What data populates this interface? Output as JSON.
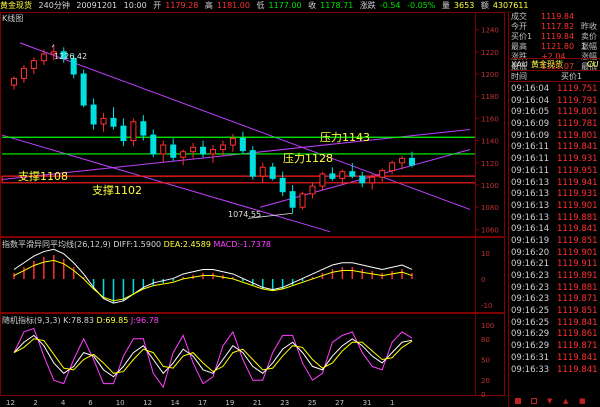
{
  "header": {
    "instrument": "黄金现货",
    "period": "240分钟",
    "date": "20091201",
    "time": "10:00",
    "open_label": "开",
    "open": "1179.28",
    "high_label": "高",
    "high": "1181.00",
    "low_label": "低",
    "low": "1177.00",
    "close_label": "收",
    "close": "1178.71",
    "change_label": "涨跌",
    "change": "-0.54",
    "change_pct": "-0.05%",
    "volume_label": "量",
    "volume": "3653",
    "amount_label": "额",
    "amount": "4307611"
  },
  "main_panel": {
    "title": "K线图",
    "price_ticks": [
      "1240",
      "1220",
      "1200",
      "1180",
      "1160",
      "1140",
      "1120",
      "1100",
      "1080",
      "1060"
    ],
    "annotations": {
      "high_label": "1226.42",
      "low_label": "1074.55",
      "resistance_1": "压力1143",
      "resistance_2": "压力1128",
      "support_1": "支撑1108",
      "support_2": "支撑1102"
    }
  },
  "macd_panel": {
    "title": "指数平滑异同平均线",
    "params": "(26,12,9)",
    "diff_label": "DIFF:1.5900",
    "dea_label": "DEA:2.4589",
    "macd_label": "MACD:-1.7378",
    "ticks": [
      "10",
      "0",
      "-10"
    ]
  },
  "kdj_panel": {
    "title": "随机指标",
    "params": "(9,3,3)",
    "k_label": "K:78.83",
    "d_label": "D:69.85",
    "j_label": "J:96.78",
    "ticks": [
      "100",
      "80",
      "50",
      "20",
      "0"
    ]
  },
  "x_axis": [
    "12",
    "2",
    "4",
    "6",
    "10",
    "12",
    "14",
    "17",
    "19",
    "21",
    "23",
    "25",
    "27",
    "31",
    "1"
  ],
  "quote": {
    "rows": [
      {
        "k": "成交",
        "v": "1119.84",
        "k2": ""
      },
      {
        "k": "今开",
        "v": "1117.82",
        "k2": "昨收"
      },
      {
        "k": "买价1",
        "v": "1119.84",
        "k2": "卖价1"
      },
      {
        "k": "最高",
        "v": "1121.80",
        "k2": "涨幅"
      },
      {
        "k": "涨跌",
        "v": "+2.04",
        "k2": "涨幅"
      },
      {
        "k": "最低",
        "v": "1121.07",
        "k2": "最低"
      }
    ],
    "tab_xau": "XAU",
    "tab_name": "黄金现货",
    "tab_cu": "CU"
  },
  "ticks": {
    "header_time": "时间",
    "header_price": "买价1",
    "rows": [
      {
        "t": "09:16:04",
        "p": "1119.751"
      },
      {
        "t": "09:16:04",
        "p": "1119.791"
      },
      {
        "t": "09:16:05",
        "p": "1119.801"
      },
      {
        "t": "09:16:09",
        "p": "1119.781"
      },
      {
        "t": "09:16:09",
        "p": "1119.801"
      },
      {
        "t": "09:16:11",
        "p": "1119.841"
      },
      {
        "t": "09:16:11",
        "p": "1119.931"
      },
      {
        "t": "09:16:11",
        "p": "1119.951"
      },
      {
        "t": "09:16:13",
        "p": "1119.941"
      },
      {
        "t": "09:16:13",
        "p": "1119.931"
      },
      {
        "t": "09:16:13",
        "p": "1119.901"
      },
      {
        "t": "09:16:13",
        "p": "1119.881"
      },
      {
        "t": "09:16:14",
        "p": "1119.841"
      },
      {
        "t": "09:16:19",
        "p": "1119.851"
      },
      {
        "t": "09:16:20",
        "p": "1119.901"
      },
      {
        "t": "09:16:21",
        "p": "1119.911"
      },
      {
        "t": "09:16:23",
        "p": "1119.891"
      },
      {
        "t": "09:16:23",
        "p": "1119.881"
      },
      {
        "t": "09:16:23",
        "p": "1119.871"
      },
      {
        "t": "09:16:25",
        "p": "1119.851"
      },
      {
        "t": "09:16:25",
        "p": "1119.841"
      },
      {
        "t": "09:16:29",
        "p": "1119.861"
      },
      {
        "t": "09:16:29",
        "p": "1119.871"
      },
      {
        "t": "09:16:31",
        "p": "1119.841"
      },
      {
        "t": "09:16:33",
        "p": "1119.841"
      }
    ]
  },
  "colors": {
    "up": "#ff3030",
    "down": "#00e0e0",
    "resistance": "#00ff00",
    "support": "#ff2020",
    "channel": "#c040ff",
    "border": "#800000",
    "label": "#ffff40",
    "line_white": "#ffffff",
    "line_yellow": "#ffff00",
    "line_magenta": "#ff40ff"
  },
  "chart_data": [
    {
      "type": "candlestick",
      "title": "K线图",
      "ylim": [
        1055,
        1245
      ],
      "series": [
        {
          "values": [
            [
              1190,
              1198,
              1186,
              1196
            ],
            [
              1196,
              1208,
              1192,
              1205
            ],
            [
              1205,
              1215,
              1200,
              1212
            ],
            [
              1212,
              1222,
              1208,
              1218
            ],
            [
              1218,
              1226.42,
              1212,
              1220
            ],
            [
              1220,
              1224,
              1210,
              1214
            ],
            [
              1214,
              1218,
              1196,
              1200
            ],
            [
              1200,
              1204,
              1170,
              1172
            ],
            [
              1172,
              1178,
              1150,
              1155
            ],
            [
              1155,
              1165,
              1148,
              1160
            ],
            [
              1160,
              1170,
              1150,
              1153
            ],
            [
              1153,
              1160,
              1135,
              1140
            ],
            [
              1140,
              1160,
              1135,
              1157
            ],
            [
              1157,
              1163,
              1140,
              1145
            ],
            [
              1145,
              1150,
              1125,
              1128
            ],
            [
              1128,
              1140,
              1120,
              1136
            ],
            [
              1136,
              1142,
              1122,
              1125
            ],
            [
              1125,
              1132,
              1118,
              1130
            ],
            [
              1130,
              1138,
              1124,
              1134
            ],
            [
              1134,
              1140,
              1125,
              1128
            ],
            [
              1128,
              1136,
              1120,
              1132
            ],
            [
              1132,
              1140,
              1126,
              1136
            ],
            [
              1136,
              1146,
              1130,
              1142
            ],
            [
              1142,
              1148,
              1128,
              1131
            ],
            [
              1131,
              1135,
              1105,
              1108
            ],
            [
              1108,
              1120,
              1102,
              1116
            ],
            [
              1116,
              1120,
              1104,
              1106
            ],
            [
              1106,
              1112,
              1090,
              1094
            ],
            [
              1094,
              1100,
              1074.55,
              1080
            ],
            [
              1080,
              1094,
              1078,
              1092
            ],
            [
              1092,
              1102,
              1088,
              1099
            ],
            [
              1099,
              1112,
              1095,
              1110
            ],
            [
              1110,
              1116,
              1104,
              1106
            ],
            [
              1106,
              1114,
              1100,
              1112
            ],
            [
              1112,
              1120,
              1106,
              1108
            ],
            [
              1108,
              1112,
              1098,
              1102
            ],
            [
              1102,
              1110,
              1096,
              1107
            ],
            [
              1107,
              1115,
              1103,
              1113
            ],
            [
              1113,
              1122,
              1110,
              1120
            ],
            [
              1120,
              1126,
              1114,
              1124
            ],
            [
              1124,
              1130,
              1116,
              1118
            ]
          ]
        }
      ]
    }
  ]
}
